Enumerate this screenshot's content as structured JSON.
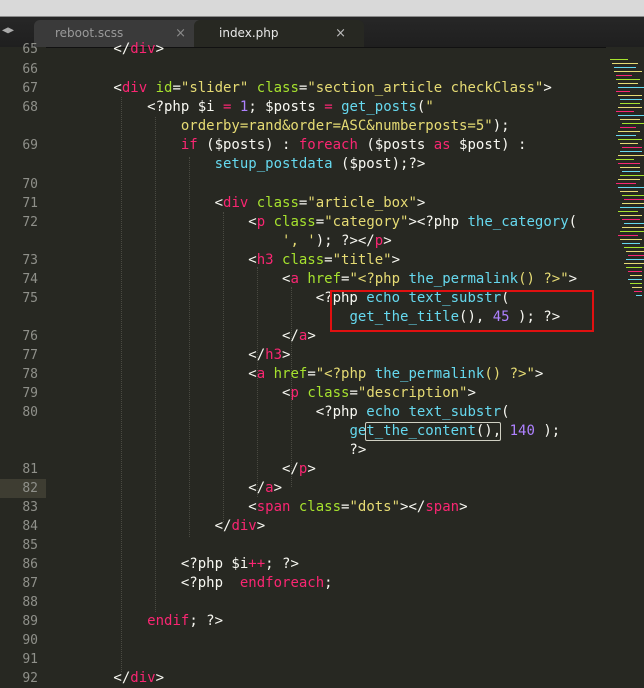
{
  "tabs": [
    {
      "label": "reboot.scss",
      "active": false,
      "close": "×"
    },
    {
      "label": "index.php",
      "active": true,
      "close": "×"
    }
  ],
  "nav": {
    "back": "◀",
    "forward": "▶"
  },
  "line_numbers": [
    "65",
    "66",
    "67",
    "68",
    "",
    "69",
    "",
    "70",
    "71",
    "72",
    "",
    "73",
    "74",
    "75",
    "",
    "76",
    "77",
    "78",
    "79",
    "80",
    "",
    "",
    "81",
    "82",
    "83",
    "84",
    "85",
    "86",
    "87",
    "88",
    "89",
    "90",
    "91",
    "92"
  ],
  "code_lines": [
    {
      "n": "65",
      "text": "        </div>"
    },
    {
      "n": "66",
      "text": ""
    },
    {
      "n": "67",
      "text": "        <div id=\"slider\" class=\"section_article checkClass\">"
    },
    {
      "n": "68",
      "text": "            <?php $i = 1; $posts = get_posts(\""
    },
    {
      "n": "",
      "text": "                orderby=rand&order=ASC&numberposts=5\");"
    },
    {
      "n": "69",
      "text": "                if ($posts) : foreach ($posts as $post) :"
    },
    {
      "n": "",
      "text": "                    setup_postdata ($post);?>"
    },
    {
      "n": "70",
      "text": ""
    },
    {
      "n": "71",
      "text": "                    <div class=\"article_box\">"
    },
    {
      "n": "72",
      "text": "                        <p class=\"category\"><?php the_category("
    },
    {
      "n": "",
      "text": "                            ', '); ?></p>"
    },
    {
      "n": "73",
      "text": "                        <h3 class=\"title\">"
    },
    {
      "n": "74",
      "text": "                            <a href=\"<?php the_permalink() ?>\">"
    },
    {
      "n": "75",
      "text": "                                <?php echo text_substr("
    },
    {
      "n": "",
      "text": "                                    get_the_title(), 45 ); ?>"
    },
    {
      "n": "76",
      "text": "                            </a>"
    },
    {
      "n": "77",
      "text": "                        </h3>"
    },
    {
      "n": "78",
      "text": "                        <a href=\"<?php the_permalink() ?>\">"
    },
    {
      "n": "79",
      "text": "                            <p class=\"description\">"
    },
    {
      "n": "80",
      "text": "                                <?php echo text_substr("
    },
    {
      "n": "",
      "text": "                                    get_the_content(), 140 );"
    },
    {
      "n": "",
      "text": "                                    ?>"
    },
    {
      "n": "81",
      "text": "                            </p>"
    },
    {
      "n": "82",
      "text": "                        </a>"
    },
    {
      "n": "83",
      "text": "                        <span class=\"dots\"></span>"
    },
    {
      "n": "84",
      "text": "                    </div>"
    },
    {
      "n": "85",
      "text": ""
    },
    {
      "n": "86",
      "text": "                <?php $i++; ?>"
    },
    {
      "n": "87",
      "text": "                <?php  endforeach;"
    },
    {
      "n": "88",
      "text": ""
    },
    {
      "n": "89",
      "text": "            endif; ?>"
    },
    {
      "n": "90",
      "text": ""
    },
    {
      "n": "91",
      "text": ""
    },
    {
      "n": "92",
      "text": "        </div>"
    }
  ],
  "current_line": "82",
  "colors": {
    "background": "#272822",
    "keyword": "#f92672",
    "attribute": "#a6e22e",
    "string": "#e6db74",
    "function": "#66d9ef",
    "number": "#ae81ff",
    "highlight_box": "#e01010"
  }
}
